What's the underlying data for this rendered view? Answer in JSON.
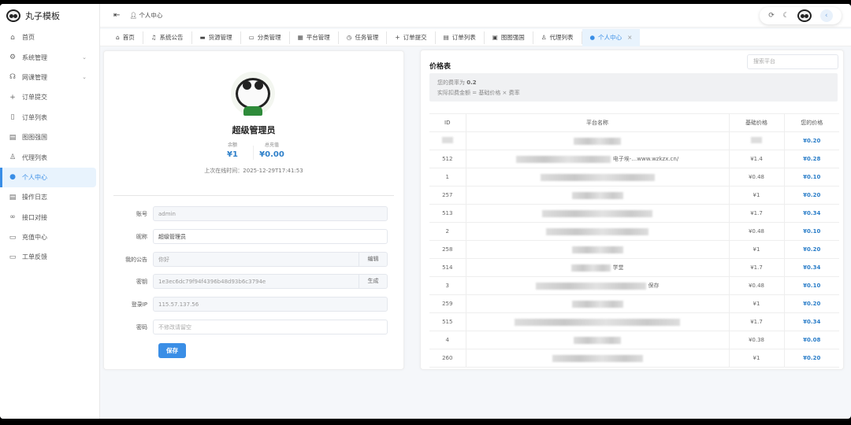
{
  "app": {
    "title": "丸子模板"
  },
  "sidebar": {
    "items": [
      {
        "label": "首页",
        "icon": "home-icon"
      },
      {
        "label": "系统管理",
        "icon": "gear-icon",
        "expandable": true
      },
      {
        "label": "网课管理",
        "icon": "headset-icon",
        "expandable": true
      },
      {
        "label": "订单提交",
        "icon": "plus-icon"
      },
      {
        "label": "订单列表",
        "icon": "document-icon"
      },
      {
        "label": "图图强国",
        "icon": "calendar-icon"
      },
      {
        "label": "代理列表",
        "icon": "user-icon"
      },
      {
        "label": "个人中心",
        "icon": "user-filled-icon",
        "active": true
      },
      {
        "label": "操作日志",
        "icon": "log-icon"
      },
      {
        "label": "接口对接",
        "icon": "link-icon"
      },
      {
        "label": "充值中心",
        "icon": "folder-icon"
      },
      {
        "label": "工单反馈",
        "icon": "message-icon"
      }
    ]
  },
  "header": {
    "breadcrumb": "个人中心"
  },
  "tabs": [
    {
      "label": "首页",
      "icon": "⌂"
    },
    {
      "label": "系统公告",
      "icon": "♫"
    },
    {
      "label": "货源管理",
      "icon": "▬"
    },
    {
      "label": "分类管理",
      "icon": "▭"
    },
    {
      "label": "平台管理",
      "icon": "▦"
    },
    {
      "label": "任务管理",
      "icon": "◷"
    },
    {
      "label": "订单提交",
      "icon": "+"
    },
    {
      "label": "订单列表",
      "icon": "▤"
    },
    {
      "label": "图图强国",
      "icon": "▣"
    },
    {
      "label": "代理列表",
      "icon": "♙"
    },
    {
      "label": "个人中心",
      "icon": "●",
      "active": true,
      "close": "×"
    }
  ],
  "profile": {
    "name": "超级管理员",
    "balance_label": "余额",
    "balance": "¥1",
    "recharged_label": "总充值",
    "recharged": "¥0.00",
    "last_login": "上次在线时间：2025-12-29T17:41:53"
  },
  "form": {
    "account": {
      "label": "账号",
      "value": "admin"
    },
    "nickname": {
      "label": "昵称",
      "value": "超级管理员"
    },
    "notice": {
      "label": "我的公告",
      "value": "你好",
      "button": "编辑"
    },
    "key": {
      "label": "密钥",
      "value": "1e3ec6dc79f94f4396b48d93b6c3794e",
      "button": "生成"
    },
    "ip": {
      "label": "登录IP",
      "value": "115.57.137.56"
    },
    "password": {
      "label": "密码",
      "placeholder": "不修改请留空"
    },
    "save": "保存"
  },
  "prices": {
    "title": "价格表",
    "search_placeholder": "搜索平台",
    "rate_text": "您的费率为",
    "rate": "0.2",
    "formula": "实际扣费金额 = 基础价格 × 费率",
    "columns": [
      "ID",
      "平台名称",
      "基础价格",
      "您的价格"
    ],
    "rows": [
      {
        "id": "",
        "name": "",
        "base": "",
        "yours": "¥0.20"
      },
      {
        "id": "512",
        "name": "电子埃-…www.wzkzx.cn/",
        "base": "¥1.4",
        "yours": "¥0.28"
      },
      {
        "id": "1",
        "name": "",
        "base": "¥0.48",
        "yours": "¥0.10"
      },
      {
        "id": "257",
        "name": "",
        "base": "¥1",
        "yours": "¥0.20"
      },
      {
        "id": "513",
        "name": "",
        "base": "¥1.7",
        "yours": "¥0.34"
      },
      {
        "id": "2",
        "name": "",
        "base": "¥0.48",
        "yours": "¥0.10"
      },
      {
        "id": "258",
        "name": "",
        "base": "¥1",
        "yours": "¥0.20"
      },
      {
        "id": "514",
        "name": "学堂",
        "base": "¥1.7",
        "yours": "¥0.34"
      },
      {
        "id": "3",
        "name": "保存",
        "base": "¥0.48",
        "yours": "¥0.10"
      },
      {
        "id": "259",
        "name": "",
        "base": "¥1",
        "yours": "¥0.20"
      },
      {
        "id": "515",
        "name": "",
        "base": "¥1.7",
        "yours": "¥0.34"
      },
      {
        "id": "4",
        "name": "",
        "base": "¥0.38",
        "yours": "¥0.08"
      },
      {
        "id": "260",
        "name": "",
        "base": "¥1",
        "yours": "¥0.20"
      }
    ]
  }
}
